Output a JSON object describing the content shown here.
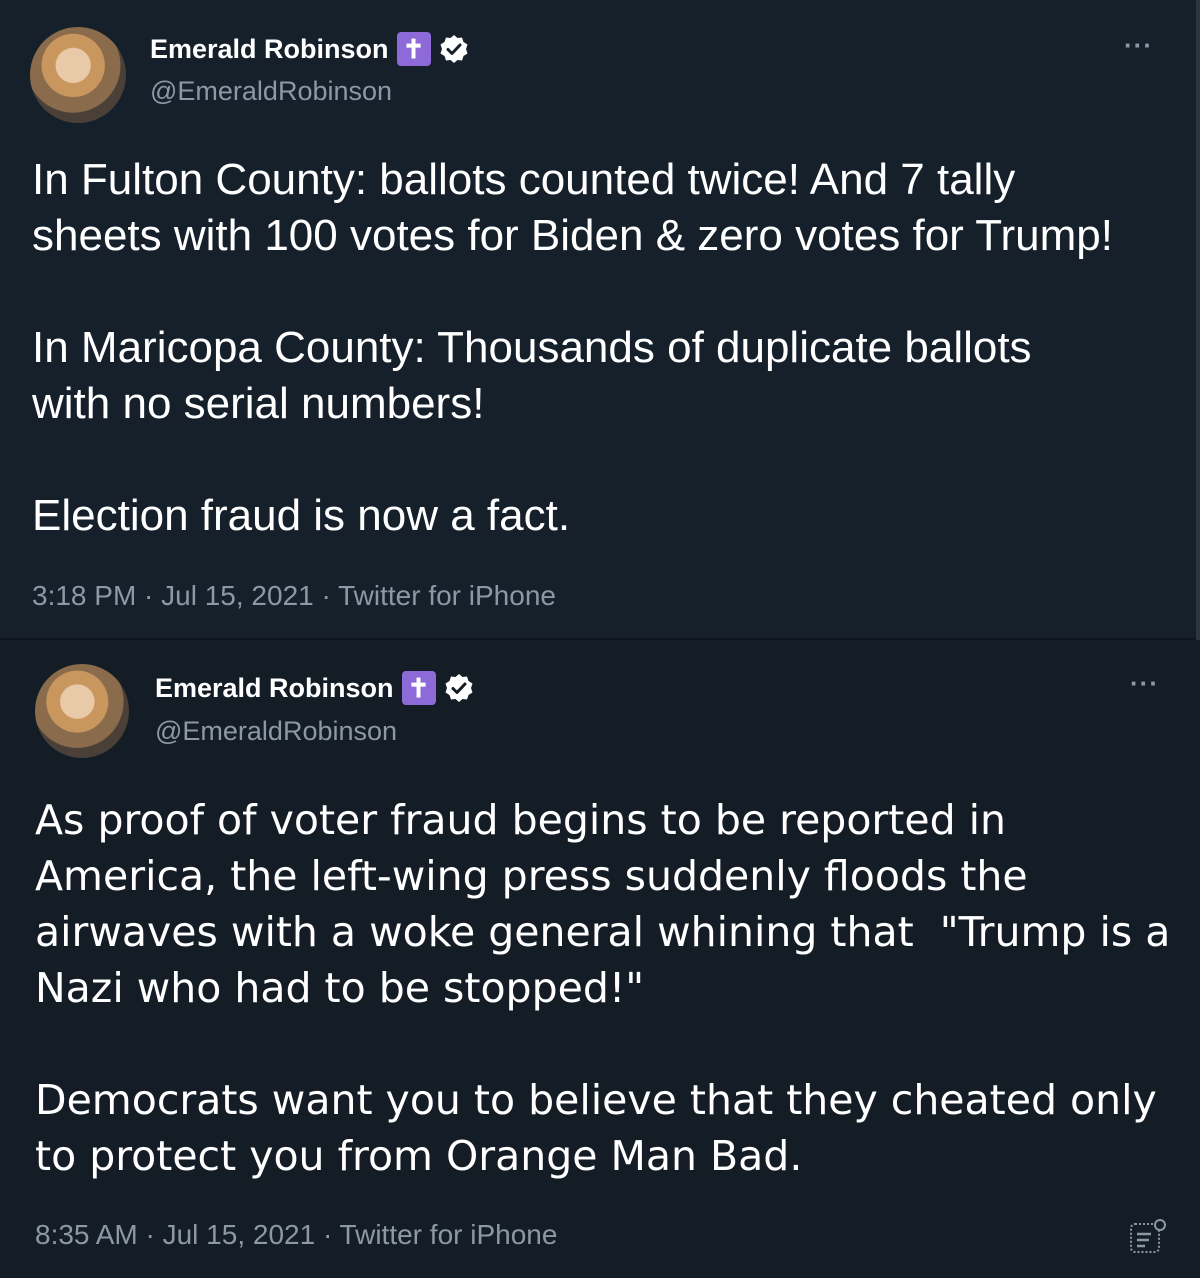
{
  "tweets": [
    {
      "author": {
        "name": "Emerald Robinson",
        "badge_glyph": "✝",
        "handle": "@EmeraldRobinson"
      },
      "more_label": "···",
      "text": "In Fulton County: ballots counted twice! And 7 tally\nsheets with 100 votes for Biden & zero votes for Trump!\n\nIn Maricopa County: Thousands of duplicate ballots\nwith no serial numbers!\n\nElection fraud is now a fact.",
      "meta": "3:18 PM · Jul 15, 2021 · Twitter for iPhone"
    },
    {
      "author": {
        "name": "Emerald Robinson",
        "badge_glyph": "✝",
        "handle": "@EmeraldRobinson"
      },
      "more_label": "···",
      "text": "As proof of voter fraud begins to be reported in\nAmerica, the left-wing press suddenly floods the\nairwaves with a woke general whining that  \"Trump is a\nNazi who had to be stopped!\"\n\nDemocrats want you to believe that they cheated only\nto protect you from Orange Man Bad.",
      "meta": "8:35 AM · Jul 15, 2021 · Twitter for iPhone"
    }
  ],
  "colors": {
    "background": "#15202b",
    "text": "#ffffff",
    "secondary_text": "#8b98a5",
    "cross_badge": "#8e6ad8",
    "verified_badge": "#ffffff"
  },
  "icons": [
    "cross-badge-icon",
    "verified-badge-icon",
    "more-options-icon",
    "analytics-icon"
  ]
}
